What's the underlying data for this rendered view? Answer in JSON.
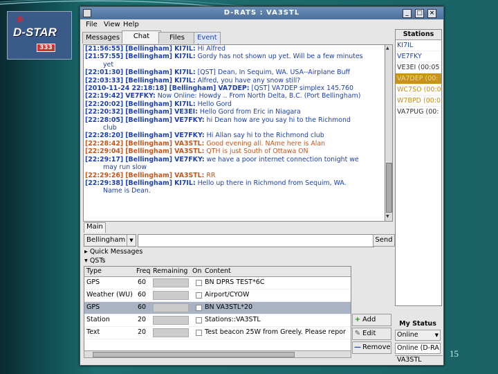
{
  "slide": {
    "page_number": "15"
  },
  "logo": {
    "text": "D-STAR",
    "badge": "333"
  },
  "window": {
    "title": "D-RATS : VA3STL"
  },
  "menu": {
    "file": "File",
    "view": "View",
    "help": "Help"
  },
  "tabs": [
    {
      "label": "Messages"
    },
    {
      "label": "Chat"
    },
    {
      "label": "Files"
    },
    {
      "label": "Event Log"
    }
  ],
  "chat": [
    {
      "time": "[21:56:55]",
      "room": "[Bellingham]",
      "nick": "KI7IL:",
      "msg": "Hi Alfred",
      "color": "blue",
      "cont": ""
    },
    {
      "time": "[21:57:55]",
      "room": "[Bellingham]",
      "nick": "KI7IL:",
      "msg": "Gordy has not shown up yet. Will be a few minutes",
      "color": "blue",
      "cont": "yet"
    },
    {
      "time": "[22:01:30]",
      "room": "[Bellingham]",
      "nick": "KI7IL:",
      "msg": "[QST] Dean, In Sequim, WA. USA--Airplane Buff",
      "color": "blue",
      "cont": ""
    },
    {
      "time": "[22:03:33]",
      "room": "[Bellingham]",
      "nick": "KI7IL:",
      "msg": "Alfred, you have any snow still?",
      "color": "blue",
      "cont": ""
    },
    {
      "time": "[2010-11-24 22:18:18]",
      "room": "[Bellingham]",
      "nick": "VA7DEP:",
      "msg": "[QST] VA7DEP simplex 145.760",
      "color": "blue",
      "cont": ""
    },
    {
      "time": "[22:19:42]",
      "room": "",
      "nick": "VE7FKY:",
      "msg": "Now Online: Howdy .. From North Delta, B.C. (Port Bellingham)",
      "color": "blue",
      "cont": ""
    },
    {
      "time": "[22:20:02]",
      "room": "[Bellingham]",
      "nick": "KI7IL:",
      "msg": "Hello Gord",
      "color": "blue",
      "cont": ""
    },
    {
      "time": "[22:20:32]",
      "room": "[Bellingham]",
      "nick": "VE3EI:",
      "msg": "Hello Gord from Eric in Niagara",
      "color": "blue",
      "cont": ""
    },
    {
      "time": "[22:28:05]",
      "room": "[Bellingham]",
      "nick": "VE7FKY:",
      "msg": "hi Dean how are you say hi to the Richmond",
      "color": "blue",
      "cont": "club"
    },
    {
      "time": "[22:28:20]",
      "room": "[Bellingham]",
      "nick": "VE7FKY:",
      "msg": "Hi Allan say hi to the Richmond club",
      "color": "blue",
      "cont": ""
    },
    {
      "time": "[22:28:42]",
      "room": "[Bellingham]",
      "nick": "VA3STL:",
      "msg": "Good evening all. NAme here is Alan",
      "color": "orange",
      "cont": ""
    },
    {
      "time": "[22:29:04]",
      "room": "[Bellingham]",
      "nick": "VA3STL:",
      "msg": "QTH is just South of Ottawa ON",
      "color": "orange",
      "cont": ""
    },
    {
      "time": "[22:29:17]",
      "room": "[Bellingham]",
      "nick": "VE7FKY:",
      "msg": "we have a poor internet connection tonight we",
      "color": "blue",
      "cont": "may run slow"
    },
    {
      "time": "[22:29:26]",
      "room": "[Bellingham]",
      "nick": "VA3STL:",
      "msg": "RR",
      "color": "orange",
      "cont": ""
    },
    {
      "time": "[22:29:38]",
      "room": "[Bellingham]",
      "nick": "KI7IL:",
      "msg": "Hello up there in Richmond from Sequim, WA.",
      "color": "blue",
      "cont": "Name is Dean."
    }
  ],
  "main_tab": "Main",
  "input": {
    "channel": "Bellingham",
    "value": "",
    "send": "Send"
  },
  "expanders": {
    "quick_messages": "Quick Messages",
    "qsts": "QSTs"
  },
  "qst": {
    "headers": [
      "Type",
      "Freq",
      "Remaining",
      "On",
      "Content"
    ],
    "rows": [
      {
        "type": "GPS",
        "freq": "60",
        "content": "BN  DPRS TEST*6C",
        "selected": false
      },
      {
        "type": "Weather (WU)",
        "freq": "60",
        "content": "Airport/CYOW",
        "selected": false
      },
      {
        "type": "GPS",
        "freq": "60",
        "content": "BN  VA3STL*20",
        "selected": true
      },
      {
        "type": "Station",
        "freq": "20",
        "content": "Stations::VA3STL",
        "selected": false
      },
      {
        "type": "Text",
        "freq": "20",
        "content": "Test beacon 25W from Greely.  Please repor",
        "selected": false
      }
    ],
    "add": "Add",
    "edit": "Edit",
    "remove": "Remove"
  },
  "stations": {
    "header": "Stations",
    "list": [
      {
        "call": "KI7IL",
        "style": "c-blue"
      },
      {
        "call": "VE7FKY",
        "style": "c-blue"
      },
      {
        "call": "VE3EI (00:05",
        "style": "c-dark"
      },
      {
        "call": "VA7DEP (00:",
        "style": "sel"
      },
      {
        "call": "WC7SO (00:0",
        "style": "c-gold"
      },
      {
        "call": "W7BPD (00:0",
        "style": "c-gold"
      },
      {
        "call": "VA7PUG (00:",
        "style": "c-dark"
      }
    ]
  },
  "my_status": {
    "label": "My Status",
    "value": "Online",
    "message": "Online (D-RA"
  },
  "statusbar": {
    "callsign": "VA3STL"
  }
}
